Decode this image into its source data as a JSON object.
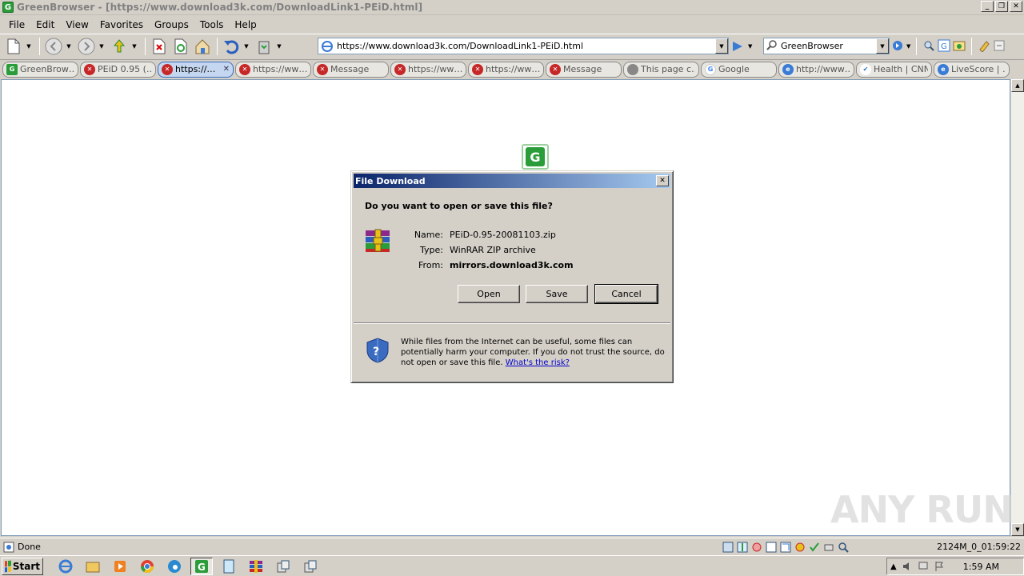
{
  "window": {
    "title": "GreenBrowser - [https://www.download3k.com/DownloadLink1-PEiD.html]"
  },
  "menu": [
    "File",
    "Edit",
    "View",
    "Favorites",
    "Groups",
    "Tools",
    "Help"
  ],
  "address": {
    "url": "https://www.download3k.com/DownloadLink1-PEiD.html"
  },
  "search": {
    "value": "GreenBrowser"
  },
  "tabs": [
    {
      "label": "GreenBrow…",
      "icon": "green"
    },
    {
      "label": "PEiD 0.95 (…",
      "icon": "err"
    },
    {
      "label": "https://…",
      "icon": "err",
      "active": true
    },
    {
      "label": "https://ww…",
      "icon": "err"
    },
    {
      "label": "Message",
      "icon": "err"
    },
    {
      "label": "https://ww…",
      "icon": "err"
    },
    {
      "label": "https://ww…",
      "icon": "err"
    },
    {
      "label": "Message",
      "icon": "err"
    },
    {
      "label": "This page c…",
      "icon": "apple"
    },
    {
      "label": "Google",
      "icon": "goog"
    },
    {
      "label": "http://www…",
      "icon": "ie"
    },
    {
      "label": "Health | CNN",
      "icon": "check"
    },
    {
      "label": "LiveScore | …",
      "icon": "ie"
    }
  ],
  "dialog": {
    "title": "File Download",
    "question": "Do you want to open or save this file?",
    "name_label": "Name:",
    "name_value": "PEiD-0.95-20081103.zip",
    "type_label": "Type:",
    "type_value": "WinRAR ZIP archive",
    "from_label": "From:",
    "from_value": "mirrors.download3k.com",
    "open_label": "Open",
    "save_label": "Save",
    "cancel_label": "Cancel",
    "warning_text": "While files from the Internet can be useful, some files can potentially harm your computer. If you do not trust the source, do not open or save this file.",
    "risk_link": "What's the risk?"
  },
  "status": {
    "text": "Done",
    "right_text": "2124M_0_01:59:22"
  },
  "taskbar": {
    "start_label": "Start",
    "clock": "1:59 AM"
  },
  "watermark": {
    "text": "ANY RUN"
  }
}
